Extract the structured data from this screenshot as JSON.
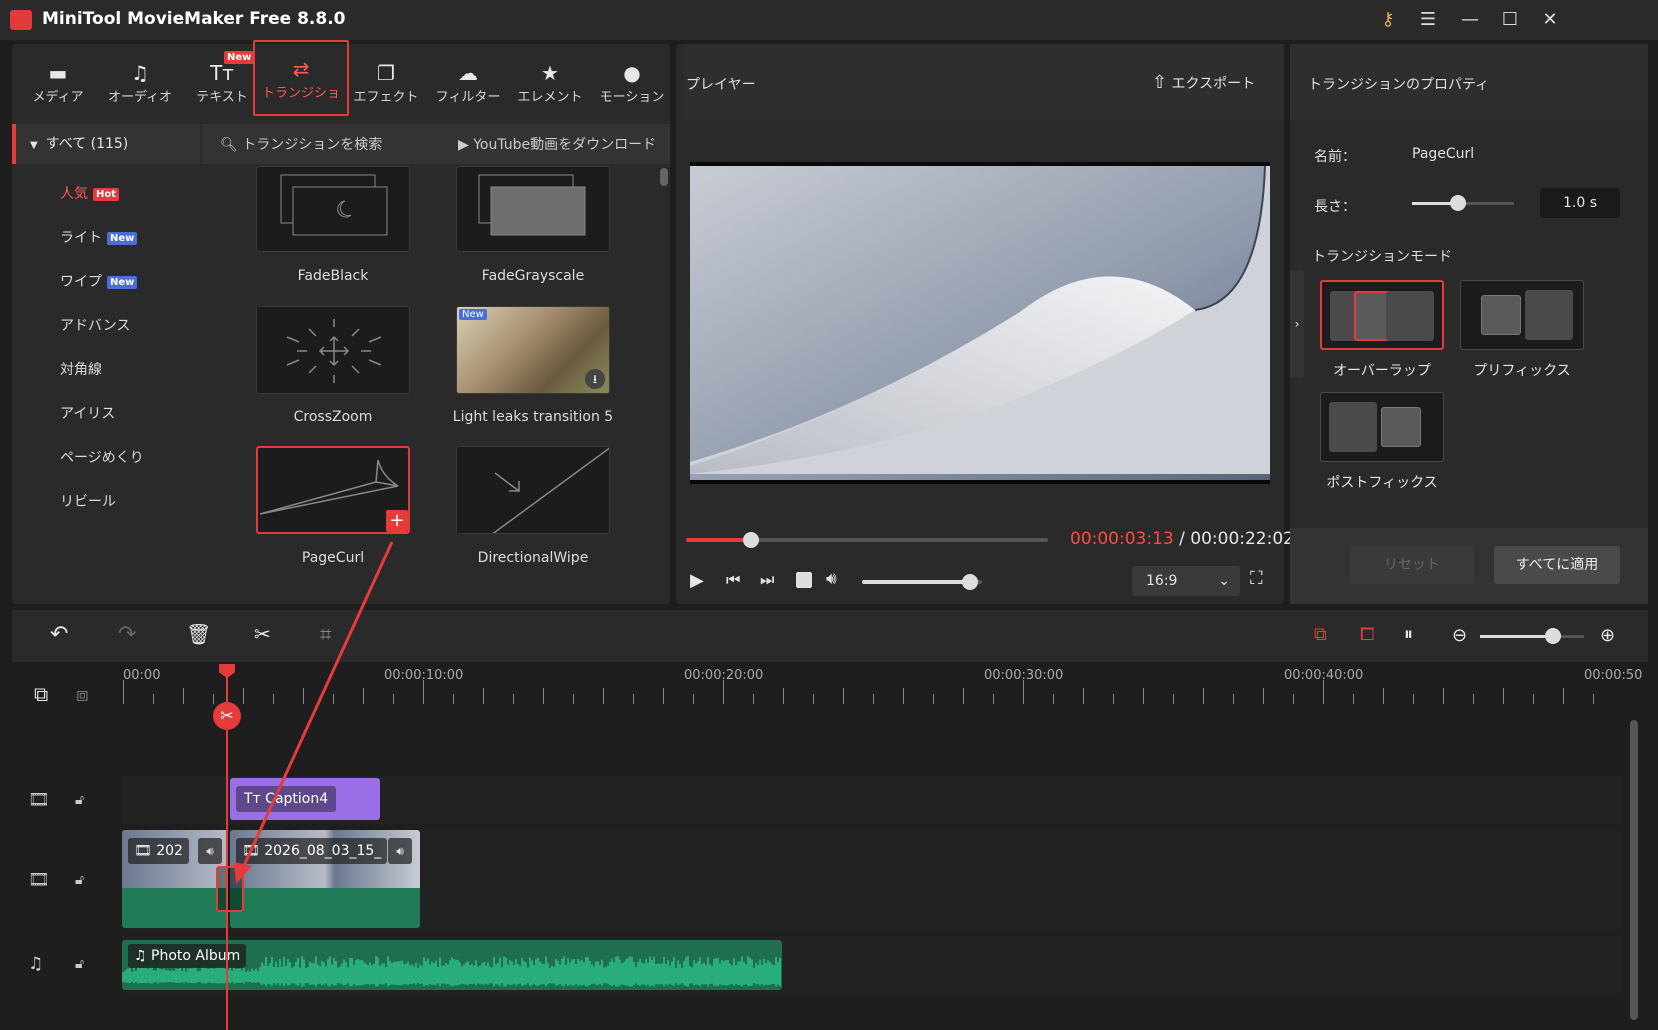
{
  "app": {
    "title": "MiniTool MovieMaker Free 8.8.0"
  },
  "titlebar": {
    "key_icon": "key-icon",
    "menu_icon": "hamburger-icon",
    "min": "—",
    "max": "☐",
    "close": "✕"
  },
  "toolbar": {
    "items": [
      {
        "label": "メディア",
        "icon": "folder-icon"
      },
      {
        "label": "オーディオ",
        "icon": "music-icon"
      },
      {
        "label": "テキスト",
        "icon": "text-icon",
        "badge": "New"
      },
      {
        "label": "トランジショ",
        "icon": "transition-icon",
        "active": true
      },
      {
        "label": "エフェクト",
        "icon": "effect-icon"
      },
      {
        "label": "フィルター",
        "icon": "filter-icon"
      },
      {
        "label": "エレメント",
        "icon": "element-icon"
      },
      {
        "label": "モーション",
        "icon": "motion-icon"
      }
    ]
  },
  "sidebar": {
    "header": "すべて (115)",
    "items": [
      {
        "label": "人気",
        "badge": "Hot"
      },
      {
        "label": "ライト",
        "badge": "New"
      },
      {
        "label": "ワイプ",
        "badge": "New"
      },
      {
        "label": "アドバンス"
      },
      {
        "label": "対角線"
      },
      {
        "label": "アイリス"
      },
      {
        "label": "ページめくり"
      },
      {
        "label": "リビール"
      }
    ]
  },
  "library": {
    "search_placeholder": "トランジションを検索",
    "youtube_label": "YouTube動画をダウンロード",
    "items": [
      "FadeBlack",
      "FadeGrayscale",
      "CrossZoom",
      "Light leaks transition 5",
      "PageCurl",
      "DirectionalWipe"
    ],
    "new_badge": "New"
  },
  "player": {
    "title": "プレイヤー",
    "export_label": "エクスポート",
    "current_time": "00:00:03:13",
    "separator": "/",
    "total_time": "00:00:22:02",
    "aspect": "16:9",
    "progress": 0.18,
    "volume": 0.9
  },
  "properties": {
    "title": "トランジションのプロパティ",
    "name_label": "名前：",
    "name_value": "PageCurl",
    "length_label": "長さ：",
    "length_value": "1.0 s",
    "length_slider": 0.45,
    "mode_label": "トランジションモード",
    "modes": [
      "オーバーラップ",
      "プリフィックス",
      "ポストフィックス"
    ],
    "reset_label": "リセット",
    "apply_all_label": "すべてに適用"
  },
  "timeline": {
    "ruler": [
      "00:00",
      "00:00:10:00",
      "00:00:20:00",
      "00:00:30:00",
      "00:00:40:00",
      "00:00:50"
    ],
    "zoom": 0.7,
    "caption_clip": "Caption4",
    "video_clip1": "202",
    "video_clip2": "2026_08_03_15_",
    "audio_clip": "Photo Album"
  },
  "colors": {
    "accent": "#e53b3b",
    "caption": "#9b6fe8",
    "video": "#1f7a55",
    "audio": "#2bc28a"
  }
}
